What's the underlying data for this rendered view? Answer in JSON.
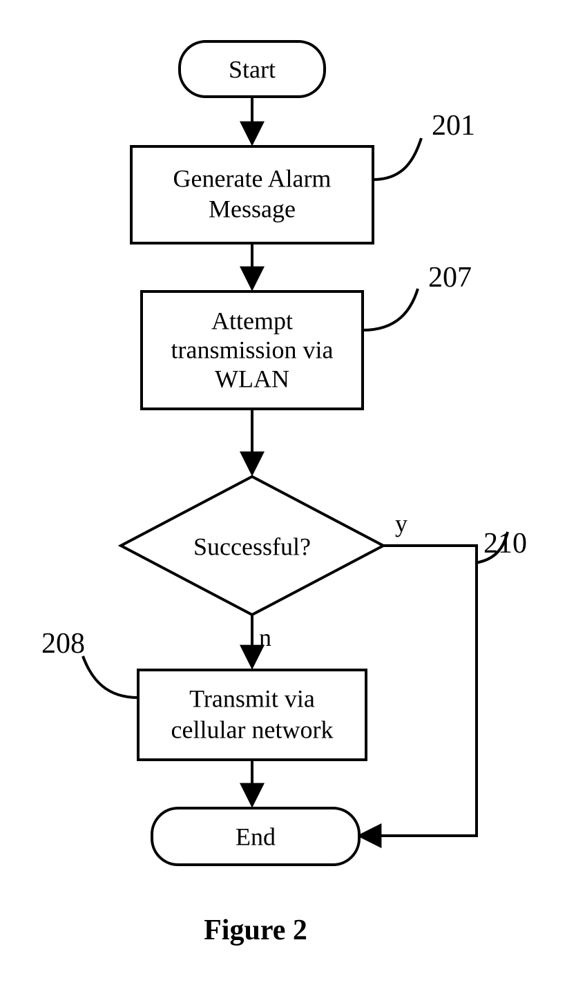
{
  "nodes": {
    "start": "Start",
    "gen1": "Generate Alarm",
    "gen2": "Message",
    "wlan1": "Attempt",
    "wlan2": "transmission via",
    "wlan3": "WLAN",
    "decision": "Successful?",
    "cell1": "Transmit via",
    "cell2": "cellular network",
    "end": "End"
  },
  "edges": {
    "yes": "y",
    "no": "n"
  },
  "refs": {
    "r201": "201",
    "r207": "207",
    "r210": "210",
    "r208": "208"
  },
  "caption": "Figure 2"
}
